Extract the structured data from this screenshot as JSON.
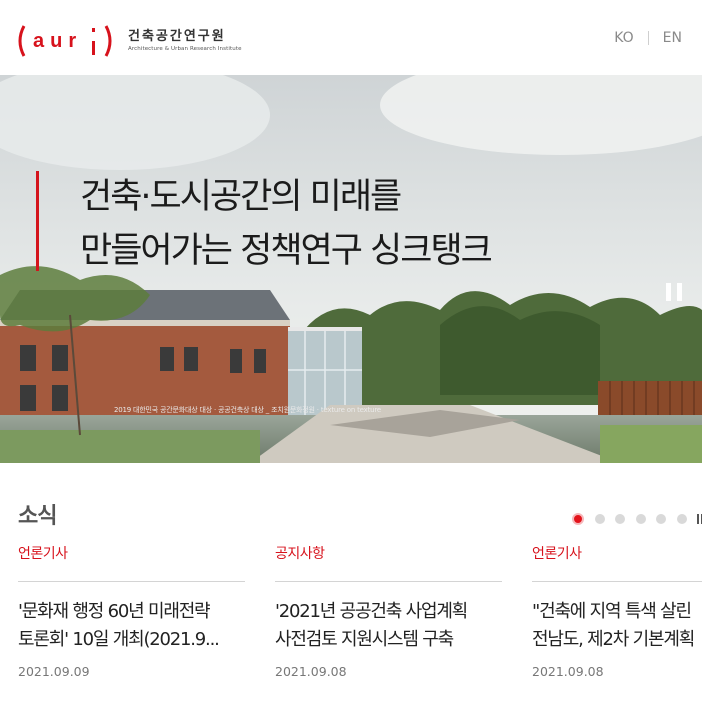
{
  "header": {
    "logo_text": "(aur i)",
    "logo_kr": "건축공간연구원",
    "logo_en": "Architecture & Urban Research Institute",
    "languages": [
      "KO",
      "EN"
    ]
  },
  "hero": {
    "title_line1": "건축·도시공간의 미래를",
    "title_line2": "만들어가는 정책연구 싱크탱크",
    "caption": "2019 대한민국 공간문화대상 대상 · 공공건축상 대상 _ 조치원문화정원 · texture on texture"
  },
  "news": {
    "section_title": "소식",
    "slider": {
      "count": 6,
      "active_index": 0
    },
    "cards": [
      {
        "category": "언론기사",
        "title": "'문화재 행정 60년 미래전략 토론회' 10일 개최(2021.9...",
        "date": "2021.09.09"
      },
      {
        "category": "공지사항",
        "title": "'2021년 공공건축 사업계획 사전검토 지원시스템 구축",
        "date": "2021.09.08"
      },
      {
        "category": "언론기사",
        "title": "\"건축에 지역 특색 살린\n전남도, 제2차 기본계획",
        "date": "2021.09.08"
      }
    ]
  },
  "colors": {
    "accent": "#d7121c",
    "text": "#222222",
    "muted": "#777777"
  }
}
